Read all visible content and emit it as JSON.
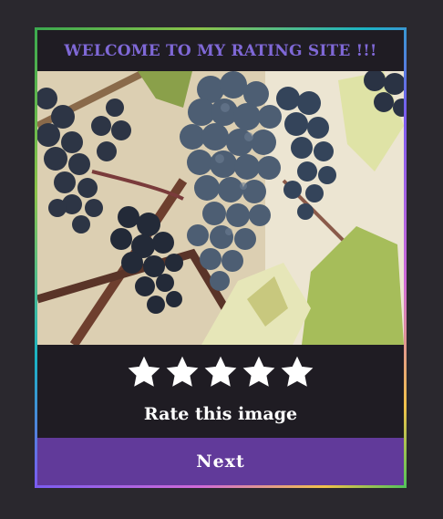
{
  "header": {
    "title": "WELCOME TO MY RATING SITE !!!"
  },
  "image": {
    "subject": "grapes-on-vine-photo"
  },
  "rating": {
    "max_stars": 5,
    "value": 5,
    "prompt": "Rate this image",
    "star_icon": "star-icon"
  },
  "actions": {
    "next_label": "Next"
  },
  "colors": {
    "page_bg": "#2a282e",
    "card_bg": "#1f1c23",
    "title_text": "#7f68d6",
    "button_bg": "#613a9a",
    "star_fill": "#ffffff"
  }
}
